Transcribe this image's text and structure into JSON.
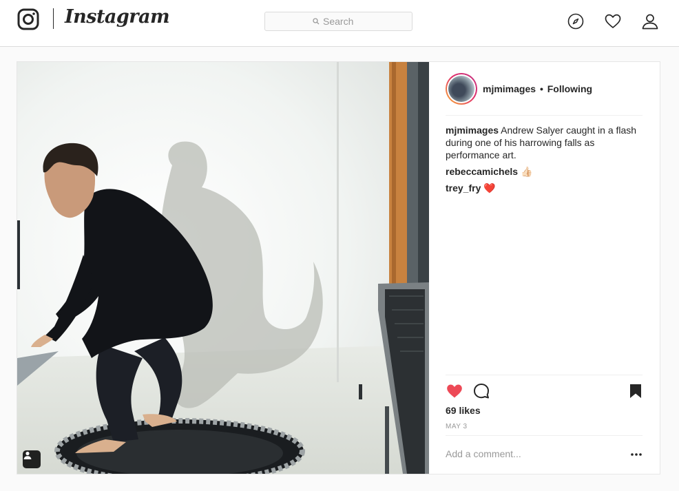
{
  "nav": {
    "wordmark": "Instagram",
    "search_placeholder": "Search",
    "icons": [
      "instagram-glyph-icon",
      "search-icon",
      "compass-icon",
      "heart-icon",
      "profile-icon"
    ]
  },
  "post": {
    "username": "mjmimages",
    "separator": "•",
    "follow_status": "Following",
    "caption": {
      "user": "mjmimages",
      "text": "Andrew Salyer caught in a flash during one of his harrowing falls as performance art."
    },
    "comments": [
      {
        "user": "rebeccamichels",
        "text": "👍🏻"
      },
      {
        "user": "trey_fry",
        "text": "❤️"
      }
    ],
    "likes": "69 likes",
    "date": "MAY 3",
    "comment_placeholder": "Add a comment...",
    "liked": true
  },
  "colors": {
    "like_red": "#ed4956",
    "text": "#262626",
    "muted": "#999999",
    "border": "#dbdbdb"
  }
}
